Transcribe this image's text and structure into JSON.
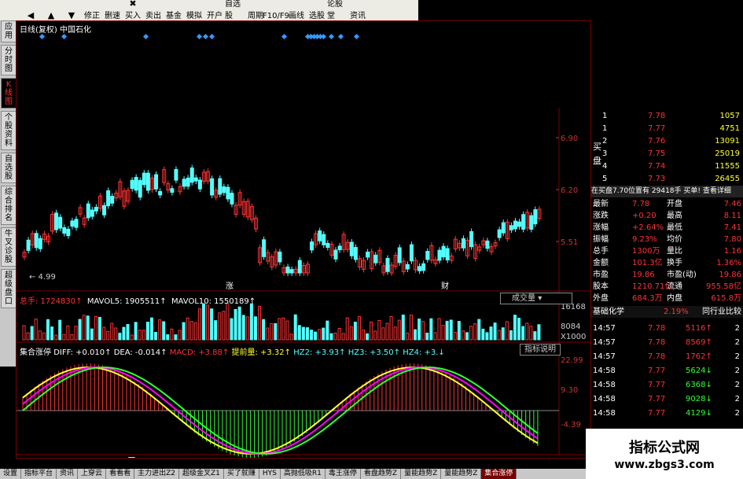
{
  "toolbar": {
    "buttons": [
      {
        "icon": "",
        "label": ""
      },
      {
        "icon": "◀",
        "label": ""
      },
      {
        "icon": "▲",
        "label": ""
      },
      {
        "icon": "▼",
        "label": ""
      },
      {
        "icon": "",
        "label": "修正"
      },
      {
        "icon": "",
        "label": "删速"
      },
      {
        "icon": "✖",
        "label": "买入"
      },
      {
        "icon": "",
        "label": "卖出"
      },
      {
        "icon": "",
        "label": "基金"
      },
      {
        "icon": "",
        "label": "模拟"
      },
      {
        "icon": "",
        "label": "开户"
      },
      {
        "icon": "",
        "label": "自选股"
      },
      {
        "icon": "",
        "label": "周期"
      },
      {
        "icon": "",
        "label": "F10/F9"
      },
      {
        "icon": "",
        "label": "画线"
      },
      {
        "icon": "",
        "label": "选股"
      },
      {
        "icon": "",
        "label": "论股堂"
      },
      {
        "icon": "",
        "label": "资讯"
      }
    ]
  },
  "left_tabs": [
    {
      "label": "应用"
    },
    {
      "label": "分时图"
    },
    {
      "label": "K线图"
    },
    {
      "label": "个股资料"
    },
    {
      "label": "自选股"
    },
    {
      "label": "综合排名"
    },
    {
      "label": "牛叉诊股"
    },
    {
      "label": "超级盘口"
    }
  ],
  "chart": {
    "title": "日线(复权)  中国石化",
    "price_axis": [
      "6.90",
      "6.20",
      "5.51"
    ],
    "low_label": "4.99",
    "event_labels": [
      "涨",
      "财"
    ],
    "vol_header": {
      "total": "总手: 1724830↑",
      "mavol5": "MAVOL5: 1905511↑",
      "mavol10": "MAVOL10: 1550189↑"
    },
    "vol_dropdown": "成交量",
    "vol_axis": [
      "16168",
      "8084",
      "X1000"
    ],
    "ind_header": {
      "name": "集合涨停",
      "diff": "DIFF: +0.010↑",
      "dea": "DEA: -0.014↑",
      "macd": "MACD: +3.88↑",
      "tq": "提前量: +3.32↑",
      "hz2": "HZ2: +3.93↑",
      "hz3": "HZ3: +3.50↑",
      "hz4": "HZ4: +3.↓"
    },
    "ind_button": "指标说明",
    "ind_axis": [
      "22.99",
      "9.30",
      "-4.39"
    ],
    "date_axis": [
      "10",
      "11",
      "2014-11-13/四",
      "12",
      "01",
      "02",
      "03",
      "04"
    ]
  },
  "orderbook": {
    "sell": [
      {
        "lv": "1",
        "price": "7.78",
        "vol": "1057"
      },
      {
        "lv": "1",
        "price": "7.77",
        "vol": "4751"
      }
    ],
    "buy_label": "买盘",
    "buy": [
      {
        "lv": "2",
        "price": "7.76",
        "vol": "13091"
      },
      {
        "lv": "3",
        "price": "7.75",
        "vol": "25019"
      },
      {
        "lv": "4",
        "price": "7.74",
        "vol": "11555"
      },
      {
        "lv": "5",
        "price": "7.73",
        "vol": "26455"
      }
    ],
    "banner": "在买盘7.70位置有  29418手  买单! 查看详细"
  },
  "quote": [
    {
      "k1": "最新",
      "v1": "7.78",
      "k2": "开盘",
      "v2": "7.46"
    },
    {
      "k1": "涨跌",
      "v1": "+0.20",
      "k2": "最高",
      "v2": "8.11"
    },
    {
      "k1": "涨幅",
      "v1": "+2.64%",
      "k2": "最低",
      "v2": "7.41"
    },
    {
      "k1": "振幅",
      "v1": "9.23%",
      "k2": "均价",
      "v2": "7.80"
    },
    {
      "k1": "总手",
      "v1": "1300万",
      "k2": "量比",
      "v2": "1.16"
    },
    {
      "k1": "金额",
      "v1": "101.3亿",
      "k2": "换手",
      "v2": "1.36%"
    },
    {
      "k1": "市盈",
      "v1": "19.86",
      "k2": "市盈(动)",
      "v2": "19.86"
    },
    {
      "k1": "股本",
      "v1": "1210.71亿",
      "k2": "流通",
      "v2": "955.58亿"
    },
    {
      "k1": "外盘",
      "v1": "684.3万",
      "k2": "内盘",
      "v2": "615.8万"
    }
  ],
  "sector": {
    "name": "基础化学",
    "pct": "2.19%",
    "compare": "同行业比较"
  },
  "ticks": [
    {
      "t": "14:57",
      "p": "7.78",
      "v": "5116",
      "d": "↑",
      "n": "2"
    },
    {
      "t": "14:57",
      "p": "7.78",
      "v": "8569",
      "d": "↑",
      "n": "2"
    },
    {
      "t": "14:57",
      "p": "7.78",
      "v": "1762",
      "d": "↑",
      "n": "2"
    },
    {
      "t": "14:58",
      "p": "7.77",
      "v": "5624",
      "d": "↓",
      "n": "2"
    },
    {
      "t": "14:58",
      "p": "7.77",
      "v": "6368",
      "d": "↓",
      "n": "2"
    },
    {
      "t": "14:58",
      "p": "7.77",
      "v": "9028",
      "d": "↓",
      "n": "2"
    },
    {
      "t": "14:58",
      "p": "7.77",
      "v": "4129",
      "d": "↓",
      "n": "2"
    }
  ],
  "bottom_tabs": [
    {
      "label": "设置"
    },
    {
      "label": "指标平台"
    },
    {
      "label": "资讯"
    },
    {
      "label": "上穿云"
    },
    {
      "label": "看看看"
    },
    {
      "label": "主力进出Z2"
    },
    {
      "label": "超级金叉Z1"
    },
    {
      "label": "买了就赚"
    },
    {
      "label": "HYS"
    },
    {
      "label": "高抛低吸R1"
    },
    {
      "label": "毒王涨停"
    },
    {
      "label": "看盘趋势Z"
    },
    {
      "label": "量能趋势Z"
    },
    {
      "label": "量能趋势Z"
    },
    {
      "label": "集合涨停"
    }
  ],
  "watermark": {
    "title": "指标公式网",
    "url": "www.zbgs3.com"
  }
}
